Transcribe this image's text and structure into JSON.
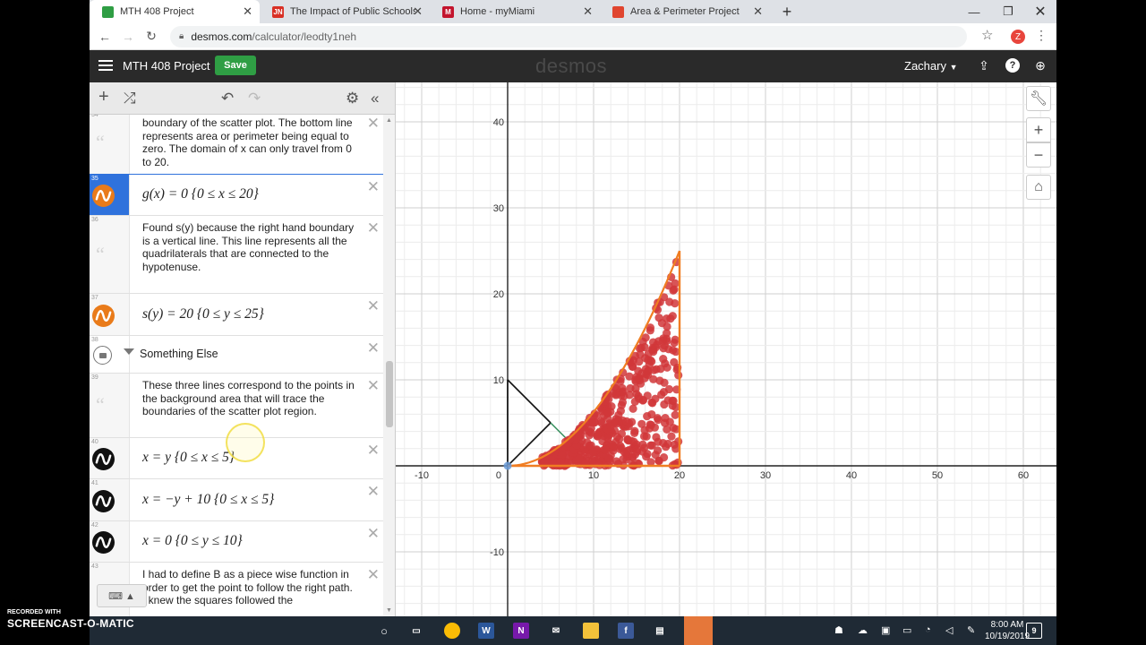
{
  "browser": {
    "tabs": [
      {
        "title": "MTH 408 Project",
        "favicon_color": "#2f9e44",
        "favicon_text": "",
        "active": true
      },
      {
        "title": "The Impact of Public Schools on",
        "favicon_color": "#d93025",
        "favicon_text": "JN",
        "active": false
      },
      {
        "title": "Home - myMiami",
        "favicon_color": "#c3142d",
        "favicon_text": "M",
        "active": false
      },
      {
        "title": "Area & Perimeter Project",
        "favicon_color": "#e0452f",
        "favicon_text": "",
        "active": false
      }
    ],
    "url_host": "desmos.com",
    "url_path": "/calculator/leodty1neh",
    "profile_initial": "Z"
  },
  "header": {
    "menu_icon": "hamburger-icon",
    "title": "MTH 408 Project",
    "save_label": "Save",
    "brand": "desmos",
    "user": "Zachary",
    "icons": [
      "share-icon",
      "help-icon",
      "globe-icon"
    ]
  },
  "expressions": [
    {
      "id": "34",
      "type": "note",
      "text": "boundary of the scatter plot.  The bottom line represents area or perimeter being equal to zero.  The domain of x can only travel from 0 to 20."
    },
    {
      "id": "35",
      "type": "math",
      "text": "g(x) = 0  {0 ≤ x ≤ 20}",
      "color": "#e97b1a",
      "selected": true
    },
    {
      "id": "36",
      "type": "note",
      "text": "Found s(y) because the right hand boundary is a vertical line.  This line represents all the quadrilaterals that are connected to the hypotenuse."
    },
    {
      "id": "37",
      "type": "math",
      "text": "s(y) = 20  {0 ≤ y ≤ 25}",
      "color": "#e97b1a"
    },
    {
      "id": "38",
      "type": "folder",
      "text": "Something Else"
    },
    {
      "id": "39",
      "type": "note",
      "text": "These three lines correspond to the points in the background area that will trace the boundaries of the scatter plot region."
    },
    {
      "id": "40",
      "type": "math",
      "text": "x = y  {0 ≤ x ≤ 5}",
      "color": "#111111"
    },
    {
      "id": "41",
      "type": "math",
      "text": "x = −y + 10 {0 ≤ x ≤ 5}",
      "color": "#111111"
    },
    {
      "id": "42",
      "type": "math",
      "text": "x = 0  {0 ≤ y ≤ 10}",
      "color": "#111111"
    },
    {
      "id": "43",
      "type": "note",
      "text": "I had to define B as a piece wise function in order to get the point to follow the right path.  I knew the squares followed the"
    }
  ],
  "graph": {
    "x_ticks": [
      "-10",
      "0",
      "10",
      "20",
      "30",
      "40",
      "50",
      "60"
    ],
    "y_ticks": [
      "40",
      "30",
      "20",
      "10",
      "-10"
    ],
    "scatter_color": "#d1373a",
    "boundary_color": "#f07d22"
  },
  "taskbar": {
    "time": "8:00 AM",
    "date": "10/19/2019",
    "notifications": "9"
  },
  "watermark": {
    "line1": "RECORDED WITH",
    "line2": "SCREENCAST-O-MATIC"
  }
}
